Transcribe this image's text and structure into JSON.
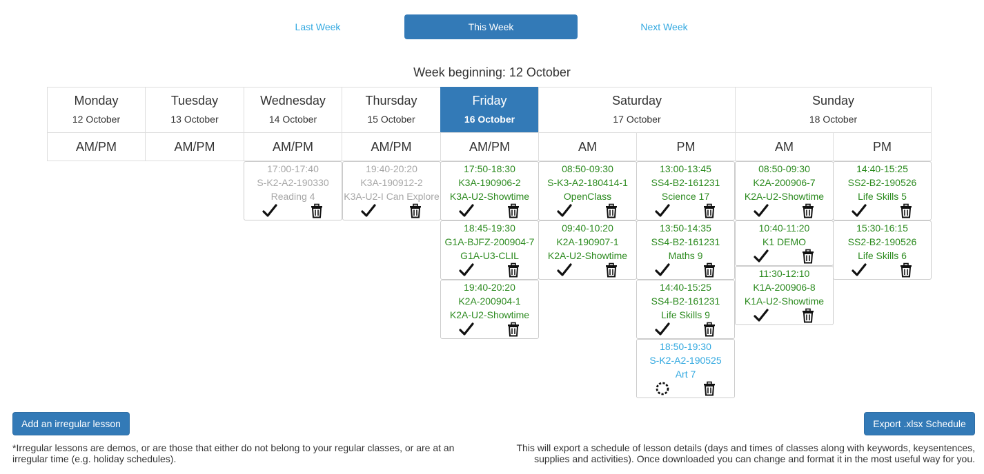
{
  "nav": {
    "last_week": "Last Week",
    "this_week": "This Week",
    "next_week": "Next Week"
  },
  "week_beginning": "Week beginning: 12 October",
  "days": [
    {
      "name": "Monday",
      "date": "12 October"
    },
    {
      "name": "Tuesday",
      "date": "13 October"
    },
    {
      "name": "Wednesday",
      "date": "14 October"
    },
    {
      "name": "Thursday",
      "date": "15 October"
    },
    {
      "name": "Friday",
      "date": "16 October"
    },
    {
      "name": "Saturday",
      "date": "17 October"
    },
    {
      "name": "Sunday",
      "date": "18 October"
    }
  ],
  "slots": {
    "ampm": "AM/PM",
    "am": "AM",
    "pm": "PM"
  },
  "lessons": {
    "wed_1": {
      "time": "17:00-17:40",
      "class": "S-K2-A2-190330",
      "title": "Reading 4",
      "status": "grey"
    },
    "thu_1": {
      "time": "19:40-20:20",
      "class": "K3A-190912-2",
      "title": "K3A-U2-I Can Explore",
      "status": "grey"
    },
    "fri_1": {
      "time": "17:50-18:30",
      "class": "K3A-190906-2",
      "title": "K3A-U2-Showtime",
      "status": "green"
    },
    "fri_2": {
      "time": "18:45-19:30",
      "class": "G1A-BJFZ-200904-7",
      "title": "G1A-U3-CLIL",
      "status": "green"
    },
    "fri_3": {
      "time": "19:40-20:20",
      "class": "K2A-200904-1",
      "title": "K2A-U2-Showtime",
      "status": "green"
    },
    "sat_am_1": {
      "time": "08:50-09:30",
      "class": "S-K3-A2-180414-1",
      "title": "OpenClass",
      "status": "green"
    },
    "sat_am_2": {
      "time": "09:40-10:20",
      "class": "K2A-190907-1",
      "title": "K2A-U2-Showtime",
      "status": "green"
    },
    "sat_pm_1": {
      "time": "13:00-13:45",
      "class": "SS4-B2-161231",
      "title": "Science 17",
      "status": "green"
    },
    "sat_pm_2": {
      "time": "13:50-14:35",
      "class": "SS4-B2-161231",
      "title": "Maths 9",
      "status": "green"
    },
    "sat_pm_3": {
      "time": "14:40-15:25",
      "class": "SS4-B2-161231",
      "title": "Life Skills 9",
      "status": "green"
    },
    "sat_pm_4": {
      "time": "18:50-19:30",
      "class": "S-K2-A2-190525",
      "title": "Art 7",
      "status": "blue"
    },
    "sun_am_1": {
      "time": "08:50-09:30",
      "class": "K2A-200906-7",
      "title": "K2A-U2-Showtime",
      "status": "green"
    },
    "sun_am_2": {
      "time": "10:40-11:20",
      "class": "K1 DEMO",
      "title": "",
      "status": "green"
    },
    "sun_am_3": {
      "time": "11:30-12:10",
      "class": "K1A-200906-8",
      "title": "K1A-U2-Showtime",
      "status": "green"
    },
    "sun_pm_1": {
      "time": "14:40-15:25",
      "class": "SS2-B2-190526",
      "title": "Life Skills 5",
      "status": "green"
    },
    "sun_pm_2": {
      "time": "15:30-16:15",
      "class": "SS2-B2-190526",
      "title": "Life Skills 6",
      "status": "green"
    }
  },
  "actions": {
    "add_irregular": "Add an irregular lesson",
    "export": "Export .xlsx Schedule"
  },
  "notes": {
    "irregular_line1": "*Irregular lessons are demos, or are those that either do not belong to your regular classes, or are at an",
    "irregular_line2": "irregular time (e.g. holiday schedules).",
    "export_line1": "This will export a schedule of lesson details (days and times of classes along with keywords, keysentences,",
    "export_line2": "supplies and activities). Once downloaded you can change and format it in the most useful way for you."
  },
  "colors": {
    "primary": "#337ab7",
    "link": "#31a8e0",
    "done": "#2b8a1e",
    "past": "#a6a6a6",
    "pending": "#31a8e0"
  }
}
